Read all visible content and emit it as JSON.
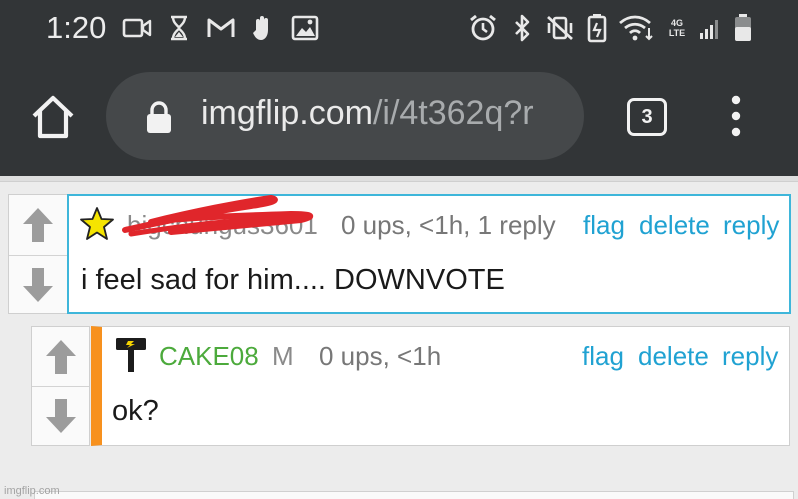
{
  "status_bar": {
    "time": "1:20",
    "icons": [
      "video-icon",
      "hourglass-icon",
      "gmail-icon",
      "hand-icon",
      "image-icon",
      "alarm-icon",
      "bluetooth-icon",
      "vibrate-mute-icon",
      "battery-saver-icon",
      "wifi-icon",
      "lte-icon",
      "signal-icon",
      "battery-icon"
    ],
    "lte_label": "4G LTE"
  },
  "browser": {
    "url_domain": "imgflip.com",
    "url_path": "/i/4t362q?r",
    "tab_count": "3"
  },
  "comments": [
    {
      "username": "bigchungus3601",
      "meta": "0 ups, <1h, 1 reply",
      "actions": [
        "flag",
        "delete",
        "reply"
      ],
      "text": "i feel sad for him.... DOWNVOTE",
      "badge": "star-icon"
    },
    {
      "username": "CAKE08",
      "mod_tag": "M",
      "meta": "0 ups, <1h",
      "actions": [
        "flag",
        "delete",
        "reply"
      ],
      "text": "ok?",
      "badge": "hammer-icon"
    }
  ],
  "watermark": "imgflip.com",
  "colors": {
    "chrome_bg": "#323537",
    "accent_blue": "#20a2d2",
    "reply_border": "#f7911e",
    "username_green": "#4caa3c",
    "scribble_red": "#e0262b"
  }
}
